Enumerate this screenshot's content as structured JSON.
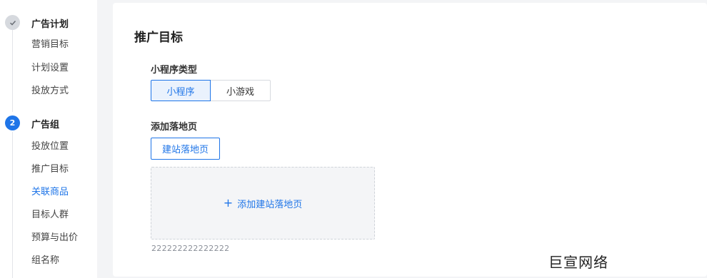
{
  "sidebar": {
    "steps": [
      {
        "title": "广告计划",
        "status_icon": "check-icon",
        "items": [
          "营销目标",
          "计划设置",
          "投放方式"
        ]
      },
      {
        "title": "广告组",
        "number": "2",
        "items": [
          "投放位置",
          "推广目标",
          "关联商品",
          "目标人群",
          "预算与出价",
          "组名称"
        ]
      }
    ]
  },
  "main": {
    "section_title": "推广目标",
    "program_type": {
      "label": "小程序类型",
      "options": [
        "小程序",
        "小游戏"
      ],
      "selected": "小程序"
    },
    "landing": {
      "label": "添加落地页",
      "build_button": "建站落地页",
      "dropzone_text": "添加建站落地页",
      "note": "222222222222222"
    }
  },
  "watermark": "巨宣网络",
  "colors": {
    "accent": "#1f75e8",
    "page_bg": "#f3f4f6",
    "selected_bg": "#eaf2fd"
  }
}
